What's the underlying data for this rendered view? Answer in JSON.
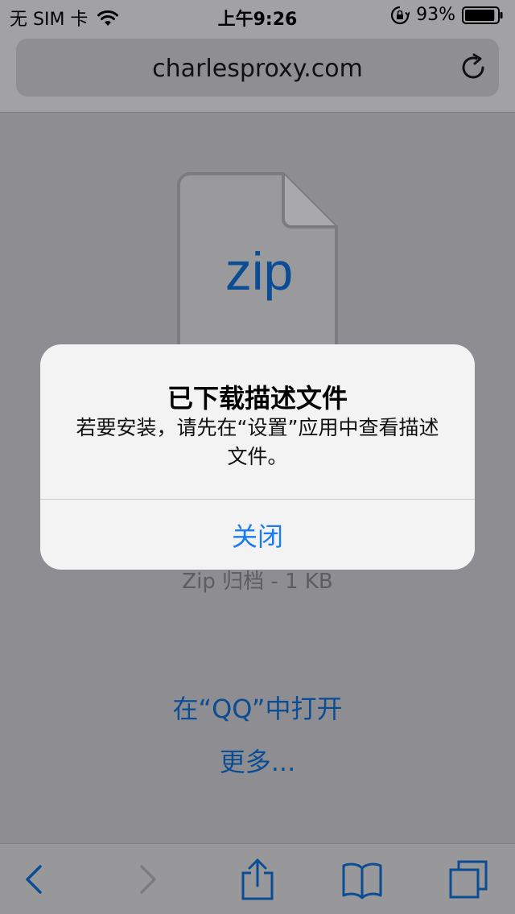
{
  "status_bar": {
    "carrier": "无 SIM 卡",
    "time": "上午9:26",
    "battery_percent": "93%",
    "battery_level": 0.93
  },
  "address_bar": {
    "url": "charlesproxy.com"
  },
  "download": {
    "file_type_label": "zip",
    "file_meta": "Zip 归档 - 1 KB",
    "open_in_link": "在“QQ”中打开",
    "more_link": "更多..."
  },
  "alert": {
    "title": "已下载描述文件",
    "message": "若要安装，请先在“设置”应用中查看描述文件。",
    "button_label": "关闭"
  },
  "toolbar": {
    "items": [
      "back-icon",
      "forward-icon",
      "share-icon",
      "bookmarks-icon",
      "tabs-icon"
    ]
  },
  "colors": {
    "accent": "#1a7cf0",
    "link_dimmed": "#0a4d94",
    "alert_bg": "#f3f3f3",
    "dim_background": "#8e8e92"
  }
}
